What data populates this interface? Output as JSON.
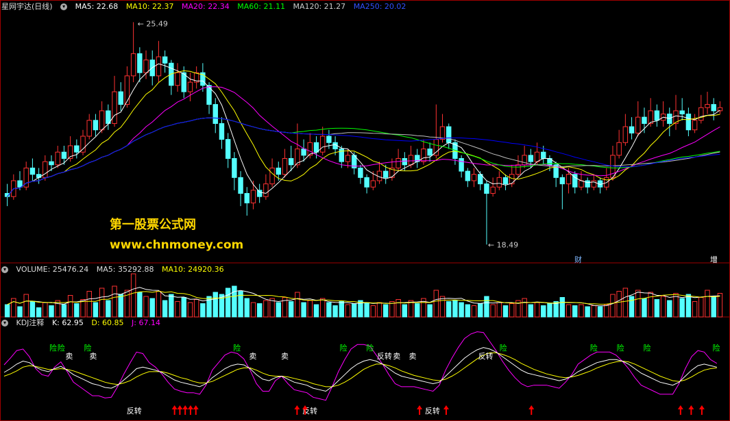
{
  "price_header": {
    "title": "星网宇达(日线)",
    "ma5": "MA5: 22.68",
    "ma10": "MA10: 22.37",
    "ma20": "MA20: 22.34",
    "ma60": "MA60: 21.11",
    "ma120": "MA120: 21.27",
    "ma250": "MA250: 20.02"
  },
  "volume_header": {
    "volume": "VOLUME: 25476.24",
    "ma5": "MA5: 35292.88",
    "ma10": "MA10: 24920.36"
  },
  "kdj_header": {
    "title": "KDJ注释",
    "k": "K: 62.95",
    "d": "D: 60.85",
    "j": "J: 67.14"
  },
  "watermark": {
    "line1": "第一股票公式网",
    "line2": "www.chnmoney.com"
  },
  "calendar_markers": {
    "cai": "财",
    "zeng": "增"
  },
  "colors": {
    "up": "#ff3232",
    "down": "#54ffff",
    "ma5": "#ffffff",
    "ma10": "#ffff00",
    "ma20": "#ff00ff",
    "ma60": "#00ff00",
    "ma120": "#c0c0c0",
    "ma250": "#0000ff",
    "k": "#ffffff",
    "d": "#ffff00",
    "j": "#ff00ff",
    "sell": "#00ff00",
    "buy": "#ff0000"
  },
  "chart_data": {
    "type": "candlestick",
    "price_high_label": "25.49",
    "price_low_label": "18.49",
    "price_range": [
      18.0,
      25.8
    ],
    "candles": [
      [
        20.1,
        20.0,
        20.4,
        19.7
      ],
      [
        20.0,
        20.5,
        20.7,
        19.9
      ],
      [
        20.5,
        20.3,
        20.8,
        20.2
      ],
      [
        20.3,
        20.9,
        21.1,
        20.2
      ],
      [
        20.9,
        20.7,
        21.2,
        20.5
      ],
      [
        20.7,
        20.6,
        20.9,
        20.4
      ],
      [
        20.6,
        21.1,
        21.3,
        20.5
      ],
      [
        21.1,
        21.0,
        21.3,
        20.8
      ],
      [
        21.0,
        21.4,
        21.6,
        20.9
      ],
      [
        21.4,
        21.2,
        21.6,
        21.0
      ],
      [
        21.2,
        21.6,
        21.9,
        21.1
      ],
      [
        21.6,
        21.4,
        21.8,
        21.2
      ],
      [
        21.4,
        21.9,
        22.1,
        21.3
      ],
      [
        21.9,
        22.4,
        22.6,
        21.8
      ],
      [
        22.4,
        22.1,
        22.6,
        21.9
      ],
      [
        22.1,
        22.7,
        23.0,
        22.0
      ],
      [
        22.7,
        22.3,
        22.9,
        22.1
      ],
      [
        22.3,
        23.3,
        23.8,
        22.2
      ],
      [
        23.3,
        22.9,
        23.6,
        22.7
      ],
      [
        22.9,
        23.8,
        24.1,
        22.8
      ],
      [
        23.8,
        24.5,
        25.49,
        23.6
      ],
      [
        24.5,
        23.9,
        24.7,
        23.6
      ],
      [
        23.9,
        24.3,
        24.6,
        23.7
      ],
      [
        24.3,
        23.8,
        24.6,
        23.5
      ],
      [
        23.8,
        24.4,
        24.9,
        23.6
      ],
      [
        24.4,
        24.2,
        24.6,
        23.9
      ],
      [
        24.2,
        23.5,
        24.3,
        23.2
      ],
      [
        23.5,
        23.9,
        24.2,
        23.3
      ],
      [
        23.9,
        23.3,
        24.1,
        23.1
      ],
      [
        23.3,
        23.6,
        23.9,
        23.0
      ],
      [
        23.6,
        23.9,
        24.1,
        23.4
      ],
      [
        23.9,
        23.5,
        24.2,
        23.3
      ],
      [
        23.5,
        22.9,
        23.6,
        22.6
      ],
      [
        22.9,
        22.3,
        23.1,
        22.0
      ],
      [
        22.3,
        21.8,
        22.5,
        21.5
      ],
      [
        21.8,
        21.2,
        22.0,
        20.9
      ],
      [
        21.2,
        20.6,
        21.4,
        20.2
      ],
      [
        20.6,
        20.1,
        20.8,
        19.7
      ],
      [
        20.1,
        19.8,
        20.3,
        19.4
      ],
      [
        19.8,
        20.2,
        20.5,
        19.6
      ],
      [
        20.2,
        20.0,
        20.4,
        19.8
      ],
      [
        20.0,
        20.4,
        20.7,
        19.9
      ],
      [
        20.4,
        20.9,
        21.2,
        20.3
      ],
      [
        20.9,
        20.7,
        21.1,
        20.5
      ],
      [
        20.7,
        21.2,
        21.5,
        20.6
      ],
      [
        21.2,
        21.0,
        21.6,
        20.8
      ],
      [
        21.0,
        21.5,
        22.3,
        20.9
      ],
      [
        21.5,
        21.3,
        21.8,
        21.1
      ],
      [
        21.3,
        21.7,
        22.0,
        21.2
      ],
      [
        21.7,
        21.4,
        21.9,
        21.2
      ],
      [
        21.4,
        21.9,
        22.2,
        21.3
      ],
      [
        21.9,
        21.7,
        22.1,
        21.5
      ],
      [
        21.7,
        21.5,
        21.9,
        21.3
      ],
      [
        21.5,
        21.1,
        21.6,
        20.9
      ],
      [
        21.1,
        21.3,
        21.5,
        20.9
      ],
      [
        21.3,
        20.9,
        21.4,
        20.7
      ],
      [
        20.9,
        20.6,
        21.0,
        20.4
      ],
      [
        20.6,
        20.3,
        20.7,
        20.1
      ],
      [
        20.3,
        20.5,
        20.8,
        20.2
      ],
      [
        20.5,
        20.8,
        21.1,
        20.4
      ],
      [
        20.8,
        20.6,
        21.0,
        20.4
      ],
      [
        20.6,
        20.9,
        21.2,
        20.5
      ],
      [
        20.9,
        21.2,
        21.5,
        20.8
      ],
      [
        21.2,
        21.0,
        21.4,
        20.8
      ],
      [
        21.0,
        21.3,
        21.6,
        20.9
      ],
      [
        21.3,
        21.1,
        21.5,
        20.9
      ],
      [
        21.1,
        21.5,
        21.8,
        21.0
      ],
      [
        21.5,
        21.3,
        21.7,
        21.1
      ],
      [
        21.3,
        21.8,
        22.9,
        21.2
      ],
      [
        21.8,
        22.2,
        22.6,
        21.7
      ],
      [
        22.2,
        21.7,
        22.3,
        21.5
      ],
      [
        21.7,
        21.2,
        21.8,
        21.0
      ],
      [
        21.2,
        20.8,
        21.3,
        20.6
      ],
      [
        20.8,
        20.5,
        20.9,
        20.3
      ],
      [
        20.5,
        20.7,
        20.9,
        20.3
      ],
      [
        20.7,
        20.4,
        20.8,
        20.2
      ],
      [
        20.4,
        20.1,
        20.5,
        18.49
      ],
      [
        20.1,
        20.3,
        20.6,
        20.0
      ],
      [
        20.3,
        20.6,
        20.8,
        20.2
      ],
      [
        20.6,
        20.4,
        20.7,
        20.2
      ],
      [
        20.4,
        20.7,
        21.0,
        20.3
      ],
      [
        20.7,
        21.0,
        21.3,
        20.6
      ],
      [
        21.0,
        21.3,
        21.6,
        20.9
      ],
      [
        21.3,
        21.1,
        21.5,
        20.9
      ],
      [
        21.1,
        21.4,
        21.7,
        21.0
      ],
      [
        21.4,
        21.2,
        21.6,
        21.0
      ],
      [
        21.2,
        21.0,
        21.3,
        20.8
      ],
      [
        21.0,
        20.6,
        21.1,
        20.3
      ],
      [
        20.6,
        20.4,
        20.7,
        19.6
      ],
      [
        20.4,
        20.7,
        20.9,
        20.1
      ],
      [
        20.7,
        20.3,
        20.8,
        20.1
      ],
      [
        20.3,
        20.5,
        20.8,
        20.2
      ],
      [
        20.5,
        20.3,
        20.6,
        20.1
      ],
      [
        20.3,
        20.5,
        20.7,
        20.2
      ],
      [
        20.5,
        20.3,
        20.6,
        20.1
      ],
      [
        20.3,
        20.6,
        20.9,
        20.2
      ],
      [
        20.6,
        21.3,
        21.6,
        20.5
      ],
      [
        21.3,
        21.7,
        22.1,
        21.2
      ],
      [
        21.7,
        22.2,
        22.6,
        21.6
      ],
      [
        22.2,
        22.0,
        22.5,
        21.8
      ],
      [
        22.0,
        22.5,
        23.0,
        21.9
      ],
      [
        22.5,
        22.3,
        22.8,
        22.0
      ],
      [
        22.3,
        22.7,
        23.1,
        22.2
      ],
      [
        22.7,
        22.4,
        22.9,
        22.2
      ],
      [
        22.4,
        22.6,
        23.0,
        22.2
      ],
      [
        22.6,
        22.3,
        22.8,
        21.9
      ],
      [
        22.3,
        22.7,
        23.2,
        22.1
      ],
      [
        22.7,
        22.6,
        23.1,
        22.4
      ],
      [
        22.6,
        22.1,
        22.8,
        21.9
      ],
      [
        22.1,
        22.4,
        22.6,
        22.0
      ],
      [
        22.4,
        22.8,
        23.2,
        22.3
      ],
      [
        22.8,
        22.9,
        23.3,
        22.6
      ],
      [
        22.9,
        22.7,
        23.1,
        22.4
      ],
      [
        22.7,
        22.8,
        23.0,
        22.6
      ]
    ],
    "volume": [
      12,
      18,
      10,
      22,
      15,
      9,
      14,
      11,
      16,
      12,
      21,
      13,
      17,
      25,
      14,
      28,
      16,
      30,
      22,
      26,
      42,
      24,
      20,
      18,
      25,
      16,
      22,
      15,
      19,
      14,
      17,
      13,
      20,
      24,
      22,
      28,
      30,
      25,
      18,
      14,
      13,
      16,
      18,
      14,
      19,
      15,
      24,
      14,
      16,
      12,
      18,
      14,
      11,
      15,
      12,
      13,
      16,
      14,
      11,
      14,
      12,
      15,
      17,
      12,
      16,
      13,
      18,
      12,
      26,
      20,
      15,
      16,
      14,
      12,
      11,
      13,
      20,
      12,
      14,
      11,
      13,
      16,
      18,
      12,
      14,
      11,
      13,
      15,
      19,
      12,
      11,
      12,
      10,
      11,
      10,
      12,
      22,
      25,
      28,
      20,
      26,
      18,
      24,
      17,
      20,
      16,
      23,
      18,
      22,
      15,
      19,
      26,
      20,
      23
    ],
    "kdj": {
      "k": [
        55,
        60,
        66,
        70,
        68,
        62,
        58,
        56,
        60,
        63,
        58,
        52,
        48,
        44,
        40,
        38,
        35,
        34,
        38,
        45,
        52,
        60,
        62,
        60,
        58,
        55,
        50,
        45,
        42,
        40,
        38,
        36,
        40,
        48,
        54,
        60,
        64,
        66,
        65,
        60,
        52,
        46,
        44,
        48,
        50,
        46,
        42,
        40,
        38,
        34,
        32,
        30,
        36,
        44,
        52,
        60,
        66,
        70,
        72,
        70,
        66,
        60,
        54,
        50,
        48,
        46,
        44,
        42,
        40,
        42,
        50,
        58,
        66,
        74,
        80,
        85,
        88,
        86,
        82,
        76,
        70,
        64,
        58,
        54,
        52,
        50,
        48,
        46,
        44,
        46,
        50,
        56,
        60,
        64,
        68,
        70,
        72,
        72,
        70,
        66,
        60,
        54,
        50,
        46,
        42,
        40,
        38,
        42,
        50,
        58,
        64,
        66,
        64,
        62
      ],
      "d": [
        50,
        53,
        57,
        62,
        64,
        63,
        61,
        59,
        59,
        60,
        59,
        57,
        54,
        51,
        48,
        45,
        42,
        40,
        39,
        41,
        44,
        49,
        53,
        56,
        56,
        56,
        54,
        51,
        48,
        46,
        43,
        41,
        41,
        43,
        47,
        51,
        55,
        59,
        61,
        61,
        58,
        54,
        51,
        50,
        50,
        49,
        47,
        45,
        43,
        40,
        38,
        36,
        36,
        38,
        42,
        47,
        53,
        59,
        63,
        66,
        66,
        64,
        61,
        57,
        54,
        51,
        49,
        47,
        45,
        44,
        46,
        50,
        55,
        61,
        67,
        73,
        78,
        81,
        81,
        79,
        76,
        72,
        67,
        63,
        59,
        56,
        53,
        51,
        49,
        48,
        49,
        51,
        54,
        57,
        61,
        64,
        67,
        69,
        70,
        69,
        66,
        62,
        58,
        54,
        50,
        47,
        44,
        43,
        45,
        49,
        54,
        58,
        60,
        61
      ],
      "j": [
        65,
        74,
        84,
        86,
        76,
        60,
        52,
        50,
        62,
        69,
        56,
        42,
        36,
        30,
        24,
        24,
        21,
        22,
        36,
        53,
        68,
        82,
        80,
        68,
        62,
        53,
        42,
        33,
        30,
        28,
        28,
        26,
        38,
        58,
        68,
        78,
        82,
        80,
        73,
        58,
        40,
        30,
        30,
        44,
        50,
        40,
        32,
        30,
        28,
        22,
        20,
        18,
        36,
        56,
        72,
        86,
        92,
        92,
        90,
        78,
        66,
        52,
        40,
        36,
        36,
        36,
        34,
        32,
        30,
        38,
        58,
        74,
        88,
        100,
        106,
        109,
        108,
        96,
        84,
        70,
        58,
        48,
        40,
        36,
        38,
        38,
        38,
        36,
        34,
        42,
        52,
        66,
        72,
        78,
        82,
        82,
        82,
        78,
        70,
        60,
        48,
        38,
        34,
        30,
        26,
        26,
        26,
        40,
        60,
        76,
        84,
        82,
        72,
        67
      ],
      "signals": [
        {
          "type": "sell",
          "label": "险",
          "i": 17
        },
        {
          "type": "sell",
          "label": "险",
          "i": 20
        },
        {
          "type": "sell",
          "label": "卖",
          "i": 23
        },
        {
          "type": "sell",
          "label": "险",
          "i": 30
        },
        {
          "type": "sell",
          "label": "卖",
          "i": 32
        },
        {
          "type": "buy",
          "label": "反转",
          "i": 46
        },
        {
          "type": "buy_arrow",
          "i": 64
        },
        {
          "type": "buy_arrow",
          "i": 66
        },
        {
          "type": "buy_arrow",
          "i": 68
        },
        {
          "type": "buy_arrow",
          "i": 70
        },
        {
          "type": "buy_arrow",
          "i": 72
        },
        {
          "type": "sell",
          "label": "险",
          "i": 86
        },
        {
          "type": "sell",
          "label": "卖",
          "i": 92
        },
        {
          "type": "sell",
          "label": "卖",
          "i": 104
        },
        {
          "type": "buy",
          "label": "反转",
          "i": 112
        },
        {
          "type": "buy_arrow",
          "i": 110
        },
        {
          "type": "buy_arrow",
          "i": 113
        },
        {
          "type": "sell",
          "label": "险",
          "i": 126
        },
        {
          "type": "sell",
          "label": "险",
          "i": 136
        },
        {
          "type": "sell",
          "label": "反转",
          "i": 140
        },
        {
          "type": "sell",
          "label": "卖",
          "i": 146
        },
        {
          "type": "sell",
          "label": "卖",
          "i": 152
        },
        {
          "type": "buy",
          "label": "反转",
          "i": 158
        },
        {
          "type": "buy_arrow",
          "i": 156
        },
        {
          "type": "buy_arrow",
          "i": 166
        },
        {
          "type": "sell",
          "label": "反转",
          "i": 178
        },
        {
          "type": "sell",
          "label": "险",
          "i": 186
        },
        {
          "type": "buy_arrow",
          "i": 198
        },
        {
          "type": "sell",
          "label": "险",
          "i": 220
        },
        {
          "type": "sell",
          "label": "险",
          "i": 230
        },
        {
          "type": "sell",
          "label": "险",
          "i": 240
        },
        {
          "type": "buy_arrow",
          "i": 254
        },
        {
          "type": "buy_arrow",
          "i": 258
        },
        {
          "type": "buy_arrow",
          "i": 262
        },
        {
          "type": "sell",
          "label": "险",
          "i": 266
        }
      ]
    }
  }
}
